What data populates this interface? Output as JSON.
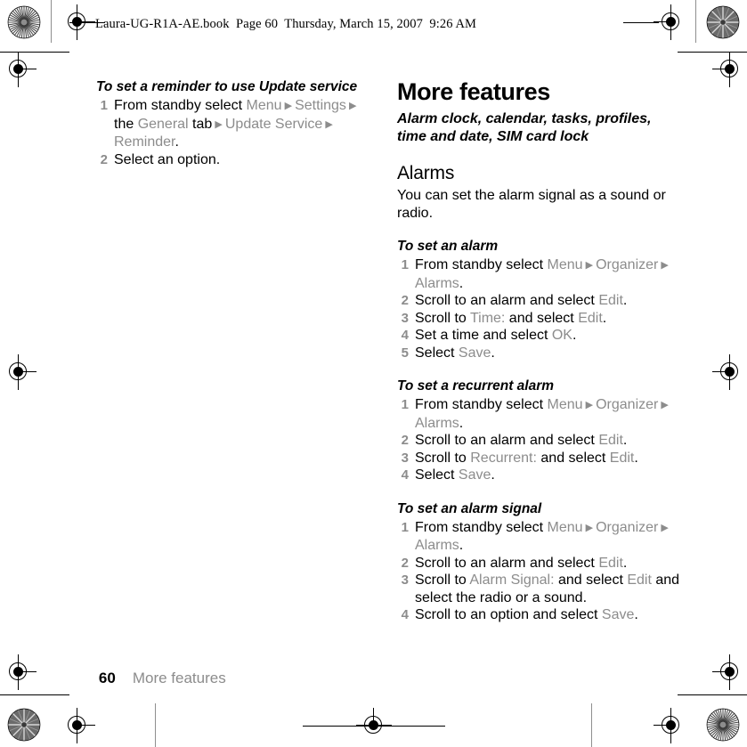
{
  "document_header": "Laura-UG-R1A-AE.book  Page 60  Thursday, March 15, 2007  9:26 AM",
  "colors": {
    "body_text": "#000000",
    "ui_string": "#8c8c8c",
    "step_number": "#8c8c8c",
    "page_background": "#ffffff"
  },
  "left_column": {
    "procedure": {
      "title": "To set a reminder to use Update service",
      "steps": [
        {
          "number": "1",
          "parts": [
            {
              "text": "From standby select ",
              "style": "body"
            },
            {
              "text": "Menu",
              "style": "ui"
            },
            {
              "text": " ▶ ",
              "style": "arrow"
            },
            {
              "text": "Settings",
              "style": "ui"
            },
            {
              "text": " ▶ ",
              "style": "arrow"
            },
            {
              "text": "the ",
              "style": "body"
            },
            {
              "text": "General",
              "style": "ui"
            },
            {
              "text": " tab",
              "style": "body"
            },
            {
              "text": " ▶ ",
              "style": "arrow"
            },
            {
              "text": "Update Service",
              "style": "ui"
            },
            {
              "text": " ▶ ",
              "style": "arrow"
            },
            {
              "text": "Reminder",
              "style": "ui"
            },
            {
              "text": ".",
              "style": "body"
            }
          ]
        },
        {
          "number": "2",
          "parts": [
            {
              "text": "Select an option.",
              "style": "body"
            }
          ]
        }
      ]
    }
  },
  "right_column": {
    "chapter_title": "More features",
    "chapter_subtitle": "Alarm clock, calendar, tasks, profiles, time and date, SIM card lock",
    "section_title": "Alarms",
    "section_intro": "You can set the alarm signal as a sound or radio.",
    "procedures": [
      {
        "title": "To set an alarm",
        "steps": [
          {
            "number": "1",
            "parts": [
              {
                "text": "From standby select ",
                "style": "body"
              },
              {
                "text": "Menu",
                "style": "ui"
              },
              {
                "text": " ▶ ",
                "style": "arrow"
              },
              {
                "text": "Organizer",
                "style": "ui"
              },
              {
                "text": " ▶ ",
                "style": "arrow"
              },
              {
                "text": "Alarms",
                "style": "ui"
              },
              {
                "text": ".",
                "style": "body"
              }
            ]
          },
          {
            "number": "2",
            "parts": [
              {
                "text": "Scroll to an alarm and select ",
                "style": "body"
              },
              {
                "text": "Edit",
                "style": "ui"
              },
              {
                "text": ".",
                "style": "body"
              }
            ]
          },
          {
            "number": "3",
            "parts": [
              {
                "text": "Scroll to ",
                "style": "body"
              },
              {
                "text": "Time:",
                "style": "ui"
              },
              {
                "text": " and select ",
                "style": "body"
              },
              {
                "text": "Edit",
                "style": "ui"
              },
              {
                "text": ".",
                "style": "body"
              }
            ]
          },
          {
            "number": "4",
            "parts": [
              {
                "text": "Set a time and select ",
                "style": "body"
              },
              {
                "text": "OK",
                "style": "ui"
              },
              {
                "text": ".",
                "style": "body"
              }
            ]
          },
          {
            "number": "5",
            "parts": [
              {
                "text": "Select ",
                "style": "body"
              },
              {
                "text": "Save",
                "style": "ui"
              },
              {
                "text": ".",
                "style": "body"
              }
            ]
          }
        ]
      },
      {
        "title": "To set a recurrent alarm",
        "steps": [
          {
            "number": "1",
            "parts": [
              {
                "text": "From standby select ",
                "style": "body"
              },
              {
                "text": "Menu",
                "style": "ui"
              },
              {
                "text": " ▶ ",
                "style": "arrow"
              },
              {
                "text": "Organizer",
                "style": "ui"
              },
              {
                "text": " ▶ ",
                "style": "arrow"
              },
              {
                "text": "Alarms",
                "style": "ui"
              },
              {
                "text": ".",
                "style": "body"
              }
            ]
          },
          {
            "number": "2",
            "parts": [
              {
                "text": "Scroll to an alarm and select ",
                "style": "body"
              },
              {
                "text": "Edit",
                "style": "ui"
              },
              {
                "text": ".",
                "style": "body"
              }
            ]
          },
          {
            "number": "3",
            "parts": [
              {
                "text": "Scroll to ",
                "style": "body"
              },
              {
                "text": "Recurrent:",
                "style": "ui"
              },
              {
                "text": " and select ",
                "style": "body"
              },
              {
                "text": "Edit",
                "style": "ui"
              },
              {
                "text": ".",
                "style": "body"
              }
            ]
          },
          {
            "number": "4",
            "parts": [
              {
                "text": "Select ",
                "style": "body"
              },
              {
                "text": "Save",
                "style": "ui"
              },
              {
                "text": ".",
                "style": "body"
              }
            ]
          }
        ]
      },
      {
        "title": "To set an alarm signal",
        "steps": [
          {
            "number": "1",
            "parts": [
              {
                "text": "From standby select ",
                "style": "body"
              },
              {
                "text": "Menu",
                "style": "ui"
              },
              {
                "text": " ▶ ",
                "style": "arrow"
              },
              {
                "text": "Organizer",
                "style": "ui"
              },
              {
                "text": " ▶ ",
                "style": "arrow"
              },
              {
                "text": "Alarms",
                "style": "ui"
              },
              {
                "text": ".",
                "style": "body"
              }
            ]
          },
          {
            "number": "2",
            "parts": [
              {
                "text": "Scroll to an alarm and select ",
                "style": "body"
              },
              {
                "text": "Edit",
                "style": "ui"
              },
              {
                "text": ".",
                "style": "body"
              }
            ]
          },
          {
            "number": "3",
            "parts": [
              {
                "text": "Scroll to ",
                "style": "body"
              },
              {
                "text": "Alarm Signal:",
                "style": "ui"
              },
              {
                "text": " and select ",
                "style": "body"
              },
              {
                "text": "Edit",
                "style": "ui"
              },
              {
                "text": " and select the radio or a sound.",
                "style": "body"
              }
            ]
          },
          {
            "number": "4",
            "parts": [
              {
                "text": "Scroll to an option and select ",
                "style": "body"
              },
              {
                "text": "Save",
                "style": "ui"
              },
              {
                "text": ".",
                "style": "body"
              }
            ]
          }
        ]
      }
    ]
  },
  "footer": {
    "page_number": "60",
    "running_head": "More features"
  }
}
